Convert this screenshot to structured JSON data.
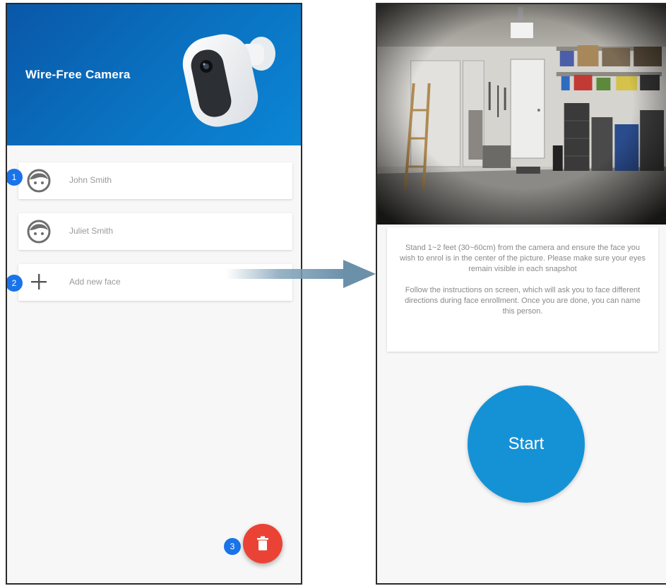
{
  "left_screen": {
    "header": {
      "title": "Wire-Free Camera"
    },
    "faces": [
      {
        "name": "John Smith"
      },
      {
        "name": "Juliet Smith"
      }
    ],
    "add_face": {
      "label": "Add new face"
    },
    "badges": {
      "one": "1",
      "two": "2",
      "three": "3"
    },
    "colors": {
      "header": "#0a73c2",
      "delete_button": "#ea4335",
      "badge": "#1a73e8"
    },
    "icons": {
      "face": "face-icon",
      "add": "plus-icon",
      "delete": "trash-icon",
      "camera": "camera-illustration"
    }
  },
  "right_screen": {
    "instructions": {
      "paragraph_1": "Stand 1~2 feet (30~60cm) from the camera and ensure the face you wish to enrol is in the center of the picture. Please make sure your eyes remain visible in each snapshot",
      "paragraph_2": "Follow the instructions on screen, which will ask you to face different directions during face enrollment. Once you are done, you can name this person."
    },
    "start_button": {
      "label": "Start"
    },
    "colors": {
      "start_button": "#1592d6"
    }
  }
}
